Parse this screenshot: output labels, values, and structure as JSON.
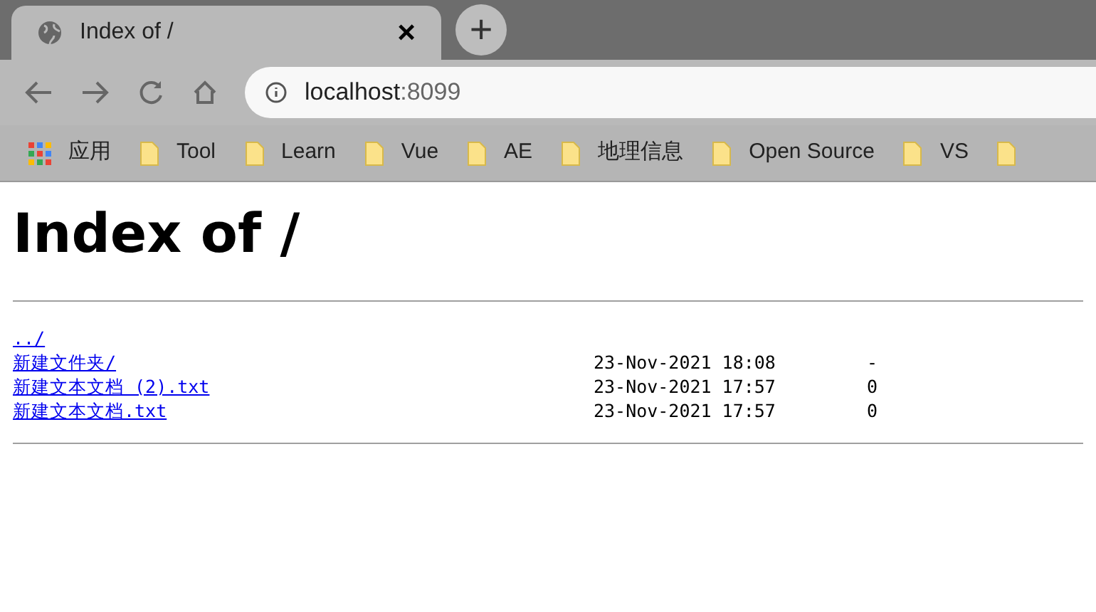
{
  "tab": {
    "title": "Index of /",
    "close": "×"
  },
  "new_tab": "+",
  "address": {
    "host": "localhost",
    "port": ":8099"
  },
  "bookmarks": [
    {
      "kind": "apps",
      "label": "应用"
    },
    {
      "kind": "folder",
      "label": "Tool"
    },
    {
      "kind": "folder",
      "label": "Learn"
    },
    {
      "kind": "folder",
      "label": "Vue"
    },
    {
      "kind": "folder",
      "label": "AE"
    },
    {
      "kind": "folder",
      "label": "地理信息"
    },
    {
      "kind": "folder",
      "label": "Open Source"
    },
    {
      "kind": "folder",
      "label": "VS"
    },
    {
      "kind": "folder"
    }
  ],
  "heading": "Index of /",
  "entries": [
    {
      "name": "../"
    },
    {
      "name": "新建文件夹/",
      "date": "23-Nov-2021 18:08",
      "size": "-"
    },
    {
      "name": "新建文本文档 (2).txt",
      "date": "23-Nov-2021 17:57",
      "size": "0"
    },
    {
      "name": "新建文本文档.txt",
      "date": "23-Nov-2021 17:57",
      "size": "0"
    }
  ]
}
